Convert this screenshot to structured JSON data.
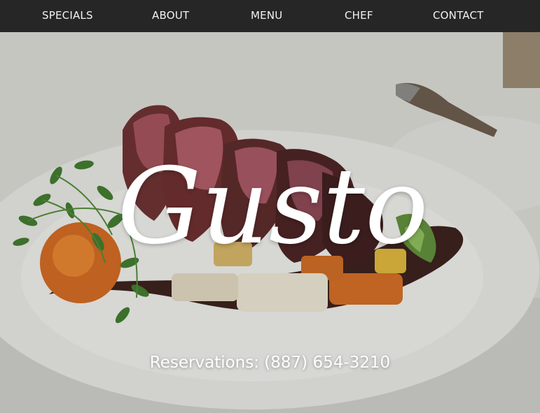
{
  "nav": {
    "items": [
      {
        "label": "SPECIALS"
      },
      {
        "label": "ABOUT"
      },
      {
        "label": "MENU"
      },
      {
        "label": "CHEF"
      },
      {
        "label": "CONTACT"
      }
    ]
  },
  "hero": {
    "logo_text": "Gusto",
    "reservations": "Reservations: (887) 654-3210"
  },
  "colors": {
    "navbar_bg": "#262626",
    "nav_text": "#f2f2f2",
    "hero_text": "#ffffff"
  }
}
